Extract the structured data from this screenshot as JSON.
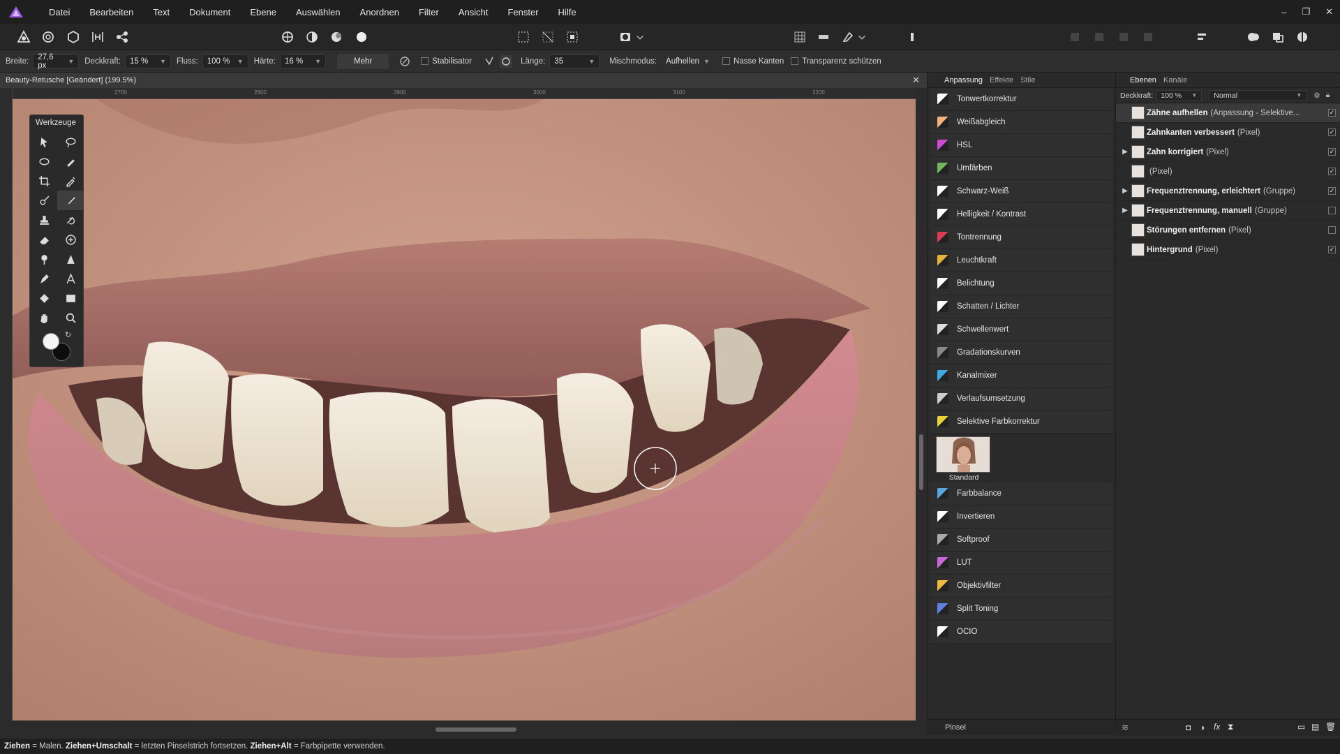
{
  "menu": {
    "items": [
      "Datei",
      "Bearbeiten",
      "Text",
      "Dokument",
      "Ebene",
      "Auswählen",
      "Anordnen",
      "Filter",
      "Ansicht",
      "Fenster",
      "Hilfe"
    ]
  },
  "window_controls": {
    "minimize": "–",
    "restore": "❐",
    "close": "✕"
  },
  "context_bar": {
    "width_label": "Breite:",
    "width_value": "27,6 px",
    "opacity_label": "Deckkraft:",
    "opacity_value": "15 %",
    "flow_label": "Fluss:",
    "flow_value": "100 %",
    "hardness_label": "Härte:",
    "hardness_value": "16 %",
    "more_label": "Mehr",
    "stabilizer_label": "Stabilisator",
    "length_label": "Länge:",
    "length_value": "35",
    "blend_label": "Mischmodus:",
    "blend_value": "Aufhellen",
    "wet_edges_label": "Nasse Kanten",
    "protect_alpha_label": "Transparenz schützen"
  },
  "document": {
    "tab_title": "Beauty-Retusche [Geändert] (199.5%)",
    "close": "✕",
    "ruler_marks": [
      "2700",
      "2800",
      "2900",
      "3000",
      "3100",
      "3200"
    ]
  },
  "tools": {
    "title": "Werkzeuge"
  },
  "adjustment_panel": {
    "tabs": [
      "Anpassung",
      "Effekte",
      "Stile"
    ],
    "items": [
      {
        "label": "Tonwertkorrektur",
        "color": "#ffffff"
      },
      {
        "label": "Weißabgleich",
        "color": "#f3b27a"
      },
      {
        "label": "HSL",
        "color": "#c84bd0"
      },
      {
        "label": "Umfärben",
        "color": "#6fb85a"
      },
      {
        "label": "Schwarz-Weiß",
        "color": "#ffffff"
      },
      {
        "label": "Helligkeit / Kontrast",
        "color": "#ffffff"
      },
      {
        "label": "Tontrennung",
        "color": "#d93a54"
      },
      {
        "label": "Leuchtkraft",
        "color": "#e5b33a"
      },
      {
        "label": "Belichtung",
        "color": "#ffffff"
      },
      {
        "label": "Schatten / Lichter",
        "color": "#ffffff"
      },
      {
        "label": "Schwellenwert",
        "color": "#dddddd"
      },
      {
        "label": "Gradationskurven",
        "color": "#888888"
      },
      {
        "label": "Kanalmixer",
        "color": "#3fa9e0"
      },
      {
        "label": "Verlaufsumsetzung",
        "color": "#cccccc"
      },
      {
        "label": "Selektive Farbkorrektur",
        "color": "#e8d338"
      }
    ],
    "preset_label": "Standard",
    "items_after": [
      {
        "label": "Farbbalance",
        "color": "#56a6e0"
      },
      {
        "label": "Invertieren",
        "color": "#ffffff"
      },
      {
        "label": "Softproof",
        "color": "#aaaaaa"
      },
      {
        "label": "LUT",
        "color": "#c968d8"
      },
      {
        "label": "Objektivfilter",
        "color": "#f0b83c"
      },
      {
        "label": "Split Toning",
        "color": "#5f7fe0"
      },
      {
        "label": "OCIO",
        "color": "#ffffff"
      }
    ],
    "brush_panel_label": "Pinsel"
  },
  "layers_panel": {
    "tabs": [
      "Ebenen",
      "Kanäle"
    ],
    "opacity_label": "Deckkraft:",
    "opacity_value": "100 %",
    "blend_value": "Normal",
    "layers": [
      {
        "name": "Zähne aufhellen",
        "type": "(Anpassung - Selektive...",
        "expander": "",
        "selected": true,
        "checked": true
      },
      {
        "name": "Zahnkanten verbessert",
        "type": "(Pixel)",
        "expander": "",
        "selected": false,
        "checked": true
      },
      {
        "name": "Zahn korrigiert",
        "type": "(Pixel)",
        "expander": "▶",
        "selected": false,
        "checked": true
      },
      {
        "name": "",
        "type": "(Pixel)",
        "expander": "",
        "selected": false,
        "checked": true
      },
      {
        "name": "Frequenztrennung, erleichtert",
        "type": "(Gruppe)",
        "expander": "▶",
        "selected": false,
        "checked": true
      },
      {
        "name": "Frequenztrennung, manuell",
        "type": "(Gruppe)",
        "expander": "▶",
        "selected": false,
        "checked": false
      },
      {
        "name": "Störungen entfernen",
        "type": "(Pixel)",
        "expander": "",
        "selected": false,
        "checked": false
      },
      {
        "name": "Hintergrund",
        "type": "(Pixel)",
        "expander": "",
        "selected": false,
        "checked": true
      }
    ]
  },
  "status_bar": {
    "k1": "Ziehen",
    "t1": " = Malen. ",
    "k2": "Ziehen+Umschalt",
    "t2": " = letzten Pinselstrich fortsetzen. ",
    "k3": "Ziehen+Alt",
    "t3": " = Farbpipette verwenden."
  }
}
